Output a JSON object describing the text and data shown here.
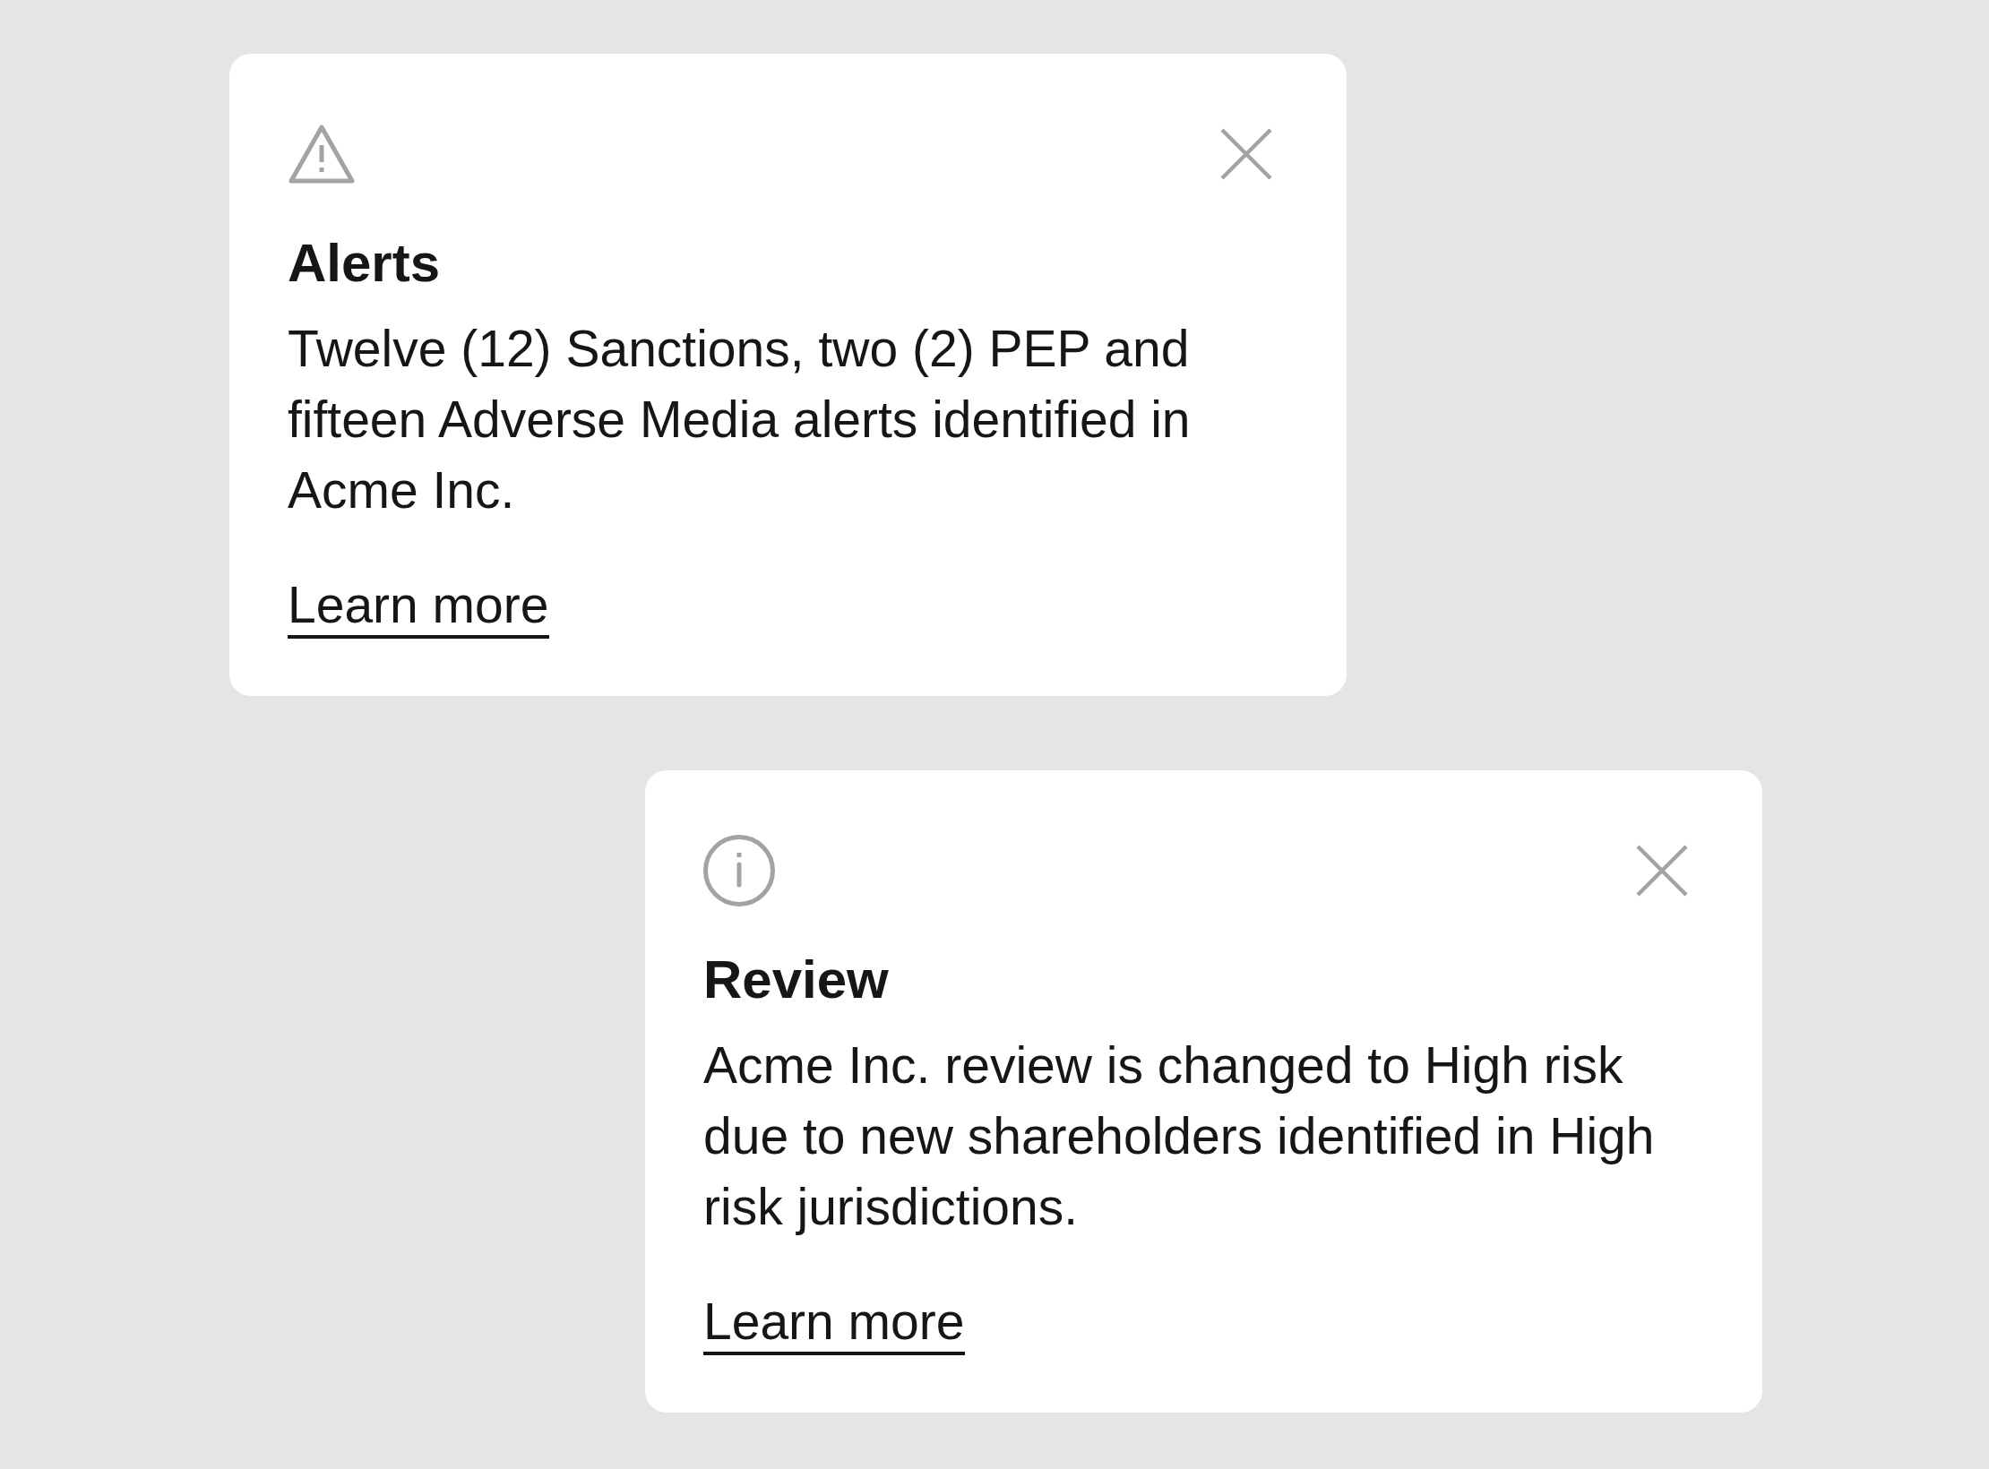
{
  "notifications": [
    {
      "kind": "warning",
      "title": "Alerts",
      "message": "Twelve (12) Sanctions, two (2) PEP and fifteen Adverse Media alerts identified in Acme Inc.",
      "link": "Learn more"
    },
    {
      "kind": "info",
      "title": "Review",
      "message": "Acme Inc. review is changed to High risk due to new shareholders identified in High risk jurisdictions.",
      "link": "Learn more"
    }
  ]
}
